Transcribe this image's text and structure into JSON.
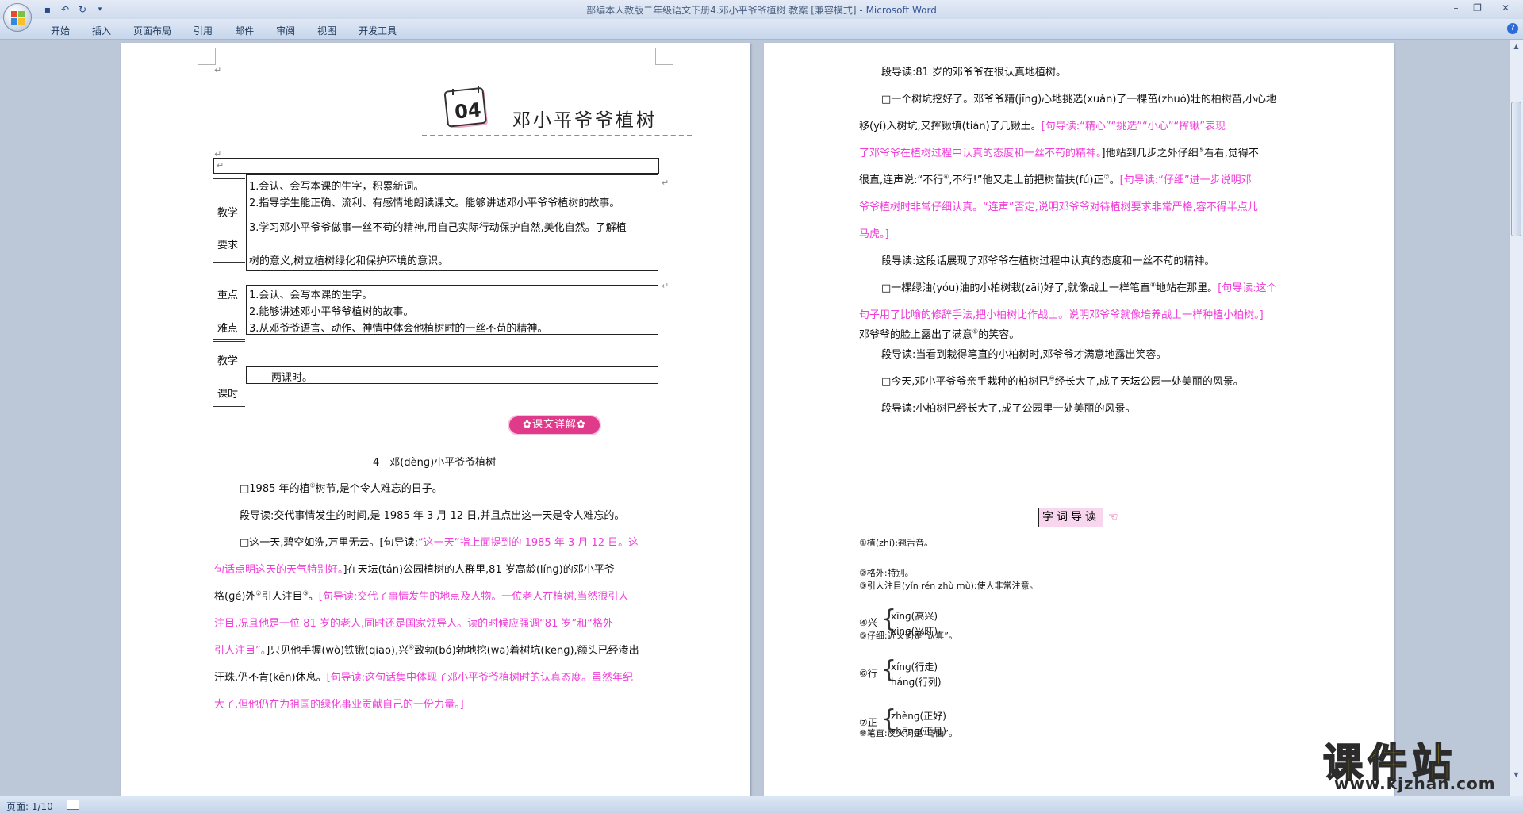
{
  "window": {
    "title": "部编本人教版二年级语文下册4.邓小平爷爷植树 教案 [兼容模式]",
    "separator": " - ",
    "app_name": "Microsoft Word"
  },
  "ribbon": {
    "tabs": [
      "开始",
      "插入",
      "页面布局",
      "引用",
      "邮件",
      "审阅",
      "视图",
      "开发工具"
    ]
  },
  "status_bar": {
    "page": "页面: 1/10"
  },
  "watermark": {
    "brand": "课件站",
    "url": "www.kjzhan.com"
  },
  "left_page": {
    "badge_number": "04",
    "title": "邓小平爷爷植树",
    "table": {
      "goals_label": [
        "教学",
        "要求"
      ],
      "goals": [
        "1.会认、会写本课的生字，积累新词。",
        "2.指导学生能正确、流利、有感情地朗读课文。能够讲述邓小平爷爷植树的故事。",
        "3.学习邓小平爷爷做事一丝不苟的精神,用自己实际行动保护自然,美化自然。了解植",
        "树的意义,树立植树绿化和保护环境的意识。"
      ],
      "key_label": [
        "重点",
        "难点"
      ],
      "key_points": [
        "1.会认、会写本课的生字。",
        "2.能够讲述邓小平爷爷植树的故事。",
        "3.从邓爷爷语言、动作、神情中体会他植树时的一丝不苟的精神。"
      ],
      "hours_label": [
        "教学",
        "课时"
      ],
      "hours": "两课时。"
    },
    "section_pill": "✿课文详解✿",
    "lesson_heading": "4　邓(dènɡ)小平爷爷植树",
    "lines": [
      {
        "segs": [
          {
            "t": "□1985 年的植",
            "c": ""
          },
          {
            "t": "①",
            "c": "sup"
          },
          {
            "t": "树节,是个令人难忘的日子。",
            "c": ""
          }
        ]
      },
      {
        "segs": [
          {
            "t": "段导读:交代事情发生的时间,是 1985 年 3 月 12 日,并且点出这一天是令人难忘的。",
            "c": ""
          }
        ]
      },
      {
        "segs": [
          {
            "t": "□这一天,碧空如洗,万里无云。[句导读:",
            "c": ""
          },
          {
            "t": "“这一天”指上面提到的 1985 年 3 月 12 日。这",
            "c": "mag"
          }
        ]
      },
      {
        "segs": [
          {
            "t": "句话点明这天的天气特别好。",
            "c": "mag"
          },
          {
            "t": "]在天坛(tán)公园植树的人群里,81 岁高龄(línɡ)的邓小平爷",
            "c": ""
          }
        ]
      },
      {
        "segs": [
          {
            "t": "格(ɡé)外",
            "c": ""
          },
          {
            "t": "②",
            "c": "sup"
          },
          {
            "t": "引人注目",
            "c": ""
          },
          {
            "t": "③",
            "c": "sup"
          },
          {
            "t": "。",
            "c": ""
          },
          {
            "t": "[句导读:交代了事情发生的地点及人物。一位老人在植树,当然很引人",
            "c": "mag"
          }
        ]
      },
      {
        "segs": [
          {
            "t": "注目,况且他是一位 81 岁的老人,同时还是国家领导人。读的时候应强调“81 岁”和“格外",
            "c": "mag"
          }
        ]
      },
      {
        "segs": [
          {
            "t": "引人注目”。",
            "c": "mag"
          },
          {
            "t": "]只见他手握(wò)铁锹(qiāo),兴",
            "c": ""
          },
          {
            "t": "④",
            "c": "sup"
          },
          {
            "t": "致勃(bó)勃地挖(wā)着树坑(kēnɡ),额头已经渗出",
            "c": ""
          }
        ]
      },
      {
        "segs": [
          {
            "t": "汗珠,仍不肯(kěn)休息。",
            "c": ""
          },
          {
            "t": "[句导读:这句话集中体现了邓小平爷爷植树时的认真态度。虽然年纪",
            "c": "mag"
          }
        ]
      },
      {
        "segs": [
          {
            "t": "大了,但他仍在为祖国的绿化事业贡献自己的一份力量。]",
            "c": "mag"
          }
        ]
      }
    ]
  },
  "right_page": {
    "lines": [
      {
        "segs": [
          {
            "t": "段导读:81 岁的邓爷爷在很认真地植树。",
            "c": ""
          }
        ]
      },
      {
        "segs": [
          {
            "t": "□一个树坑挖好了。邓爷爷精(jīnɡ)心地挑选(xuǎn)了一棵茁(zhuó)壮的柏树苗,小心地",
            "c": ""
          }
        ]
      },
      {
        "segs": [
          {
            "t": "移(yí)入树坑,又挥锹填(tián)了几锹土。",
            "c": ""
          },
          {
            "t": "[句导读:“精心”“挑选”“小心”“挥锹”表现",
            "c": "mag"
          }
        ]
      },
      {
        "segs": [
          {
            "t": "了邓爷爷在植树过程中认真的态度和一丝不苟的精神。",
            "c": "mag"
          },
          {
            "t": "]他站到几步之外仔细",
            "c": ""
          },
          {
            "t": "⑤",
            "c": "sup"
          },
          {
            "t": "看看,觉得不",
            "c": ""
          }
        ]
      },
      {
        "segs": [
          {
            "t": "很直,连声说:“不行",
            "c": ""
          },
          {
            "t": "⑥",
            "c": "sup"
          },
          {
            "t": ",不行!”他又走上前把树苗扶(fú)正",
            "c": ""
          },
          {
            "t": "⑦",
            "c": "sup"
          },
          {
            "t": "。",
            "c": ""
          },
          {
            "t": "[句导读:“仔细”进一步说明邓",
            "c": "mag"
          }
        ]
      },
      {
        "segs": [
          {
            "t": "爷爷植树时非常仔细认真。“连声”否定,说明邓爷爷对待植树要求非常严格,容不得半点儿",
            "c": "mag"
          }
        ]
      },
      {
        "segs": [
          {
            "t": "马虎。]",
            "c": "mag"
          }
        ]
      },
      {
        "segs": [
          {
            "t": "段导读:这段话展现了邓爷爷在植树过程中认真的态度和一丝不苟的精神。",
            "c": ""
          }
        ]
      },
      {
        "segs": [
          {
            "t": "□一棵绿油(yóu)油的小柏树栽(zāi)好了,就像战士一样笔直",
            "c": ""
          },
          {
            "t": "⑧",
            "c": "sup"
          },
          {
            "t": "地站在那里。",
            "c": ""
          },
          {
            "t": "[句导读:这个",
            "c": "mag"
          }
        ]
      },
      {
        "segs": [
          {
            "t": "句子用了比喻的修辞手法,把小柏树比作战士。说明邓爷爷就像培养战士一样种植小柏树。]",
            "c": "mag"
          }
        ]
      },
      {
        "segs": [
          {
            "t": "邓爷爷的脸上露出了满意",
            "c": ""
          },
          {
            "t": "⑨",
            "c": "sup"
          },
          {
            "t": "的笑容。",
            "c": ""
          }
        ]
      },
      {
        "segs": [
          {
            "t": "段导读:当看到栽得笔直的小柏树时,邓爷爷才满意地露出笑容。",
            "c": ""
          }
        ]
      },
      {
        "segs": [
          {
            "t": "□今天,邓小平爷爷亲手栽种的柏树已",
            "c": ""
          },
          {
            "t": "⑩",
            "c": "sup"
          },
          {
            "t": "经长大了,成了天坛公园一处美丽的风景。",
            "c": ""
          }
        ]
      },
      {
        "segs": [
          {
            "t": "段导读:小柏树已经长大了,成了公园里一处美丽的风景。",
            "c": ""
          }
        ]
      }
    ],
    "glossary_title": "字词导读",
    "glossary": [
      "①植(zhí):翘舌音。",
      "②格外:特别。",
      "③引人注目(yǐn rén zhù mù):使人非常注意。",
      "⑤仔细:近义词是“认真”。",
      "⑧笔直:反义词是“弯曲”。"
    ],
    "poly": [
      {
        "char": "④兴",
        "a": "xīnɡ(高兴)",
        "b": "xìnɡ(兴旺)"
      },
      {
        "char": "⑥行",
        "a": "xínɡ(行走)",
        "b": "hánɡ(行列)"
      },
      {
        "char": "⑦正",
        "a": "zhènɡ(正好)",
        "b": "zhēnɡ(正月)"
      }
    ]
  }
}
